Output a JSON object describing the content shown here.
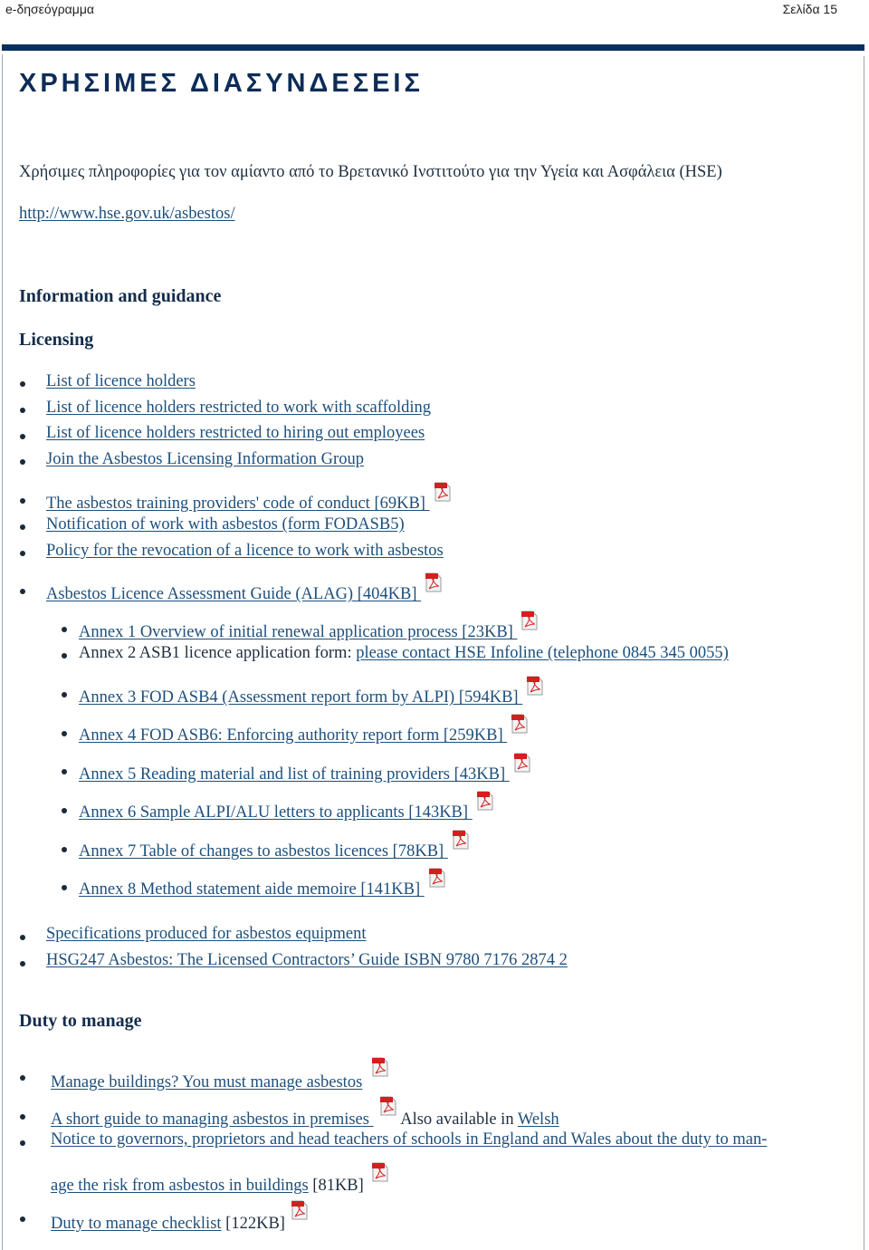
{
  "header": {
    "left": "e-δησεόγραμμα",
    "page": "Σελίδα 15"
  },
  "title": "ΧΡΗΣΙΜΕΣ ΔΙΑΣΥΝΔΕΣΕΙΣ",
  "intro": "Χρήσιμες πληροφορίες για τον αμίαντο από το Βρετανικό Ινστιτούτο για την Υγεία και Ασφάλεια  (HSE)",
  "url": "http://www.hse.gov.uk/asbestos/",
  "headings": {
    "info": "Information and guidance",
    "licensing": "Licensing",
    "duty": "Duty to manage"
  },
  "licensing_items": [
    "List of licence holders",
    "List of licence holders restricted to work with scaffolding",
    "List of licence holders restricted to hiring out employees",
    "Join the Asbestos Licensing Information Group",
    "The asbestos training providers' code of conduct [69KB] ",
    "Notification of work with asbestos (form FODASB5)",
    "Policy for the revocation of a licence to work with asbestos",
    "Asbestos Licence Assessment Guide (ALAG) [404KB] "
  ],
  "annexes": [
    {
      "text": "Annex 1 Overview of initial renewal application process [23KB] "
    },
    {
      "prefix": "Annex 2 ASB1 licence application form: ",
      "text": "please contact HSE Infoline (telephone 0845 345 0055)"
    },
    {
      "text": "Annex 3 FOD ASB4 (Assessment report form by ALPI) [594KB] "
    },
    {
      "text": "Annex 4 FOD ASB6: Enforcing authority report form [259KB] "
    },
    {
      "text": "Annex 5 Reading material and list of training providers [43KB] "
    },
    {
      "text": "Annex 6 Sample ALPI/ALU letters to applicants [143KB] "
    },
    {
      "text": "Annex 7 Table of changes to asbestos licences [78KB] "
    },
    {
      "text": "Annex 8 Method statement aide memoire [141KB] "
    }
  ],
  "more_items": [
    "Specifications produced for asbestos equipment",
    "HSG247 Asbestos: The Licensed Contractors’ Guide ISBN 9780 7176 2874 2"
  ],
  "duty_items": {
    "manage": "Manage buildings? You must manage asbestos",
    "short_guide": "A short guide to managing asbestos in premises ",
    "also": " Also available in ",
    "welsh": "Welsh",
    "notice_line1": "Notice to governors, proprietors and head teachers of schools in England and Wales about the duty to man-",
    "notice_line2": "age the risk from asbestos in buildings",
    "notice_size": " [81KB]",
    "checklist": "Duty to manage checklist",
    "checklist_size": " [122KB]"
  },
  "icons": {
    "pdf": "pdf-file-icon",
    "bullet": "bullet"
  },
  "colors": {
    "accent_bar": "#0b2f5c",
    "link": "#1d4f7c",
    "title": "#0d2c57"
  }
}
